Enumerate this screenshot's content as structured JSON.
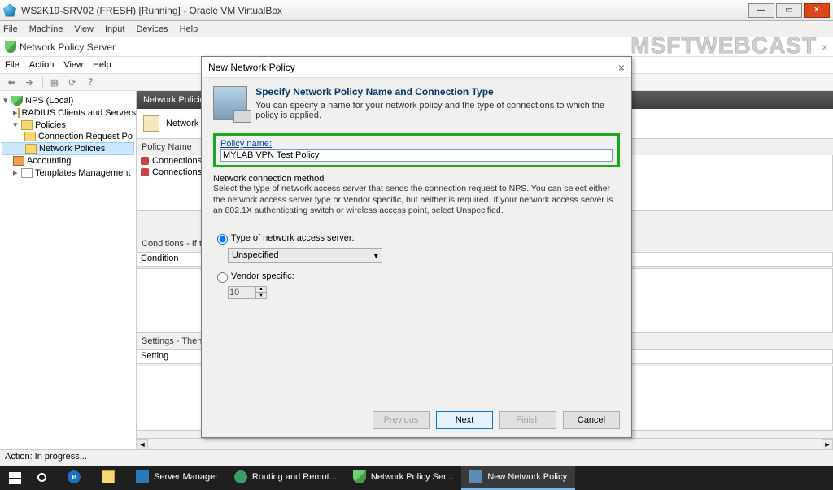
{
  "vbox": {
    "title": "WS2K19-SRV02 (FRESH) [Running] - Oracle VM VirtualBox",
    "menu": [
      "File",
      "Machine",
      "View",
      "Input",
      "Devices",
      "Help"
    ]
  },
  "watermark": "MSFTWEBCAST",
  "nps": {
    "title": "Network Policy Server",
    "menu": [
      "File",
      "Action",
      "View",
      "Help"
    ],
    "tree": {
      "root": "NPS (Local)",
      "radius": "RADIUS Clients and Servers",
      "policies": "Policies",
      "conn_req": "Connection Request Po",
      "net_pol": "Network Policies",
      "accounting": "Accounting",
      "templates": "Templates Management"
    },
    "col_header": "Network Policies",
    "banner_text": "Network policie",
    "policy_name_hdr": "Policy Name",
    "rows": [
      "Connections to Micr",
      "Connections to othe"
    ],
    "conditions_label": "Conditions - If the fol",
    "condition_hdr": "Condition",
    "settings_label": "Settings - Then the fo",
    "setting_hdr": "Setting",
    "status": "Action: In progress..."
  },
  "dialog": {
    "title": "New Network Policy",
    "heading": "Specify Network Policy Name and Connection Type",
    "sub": "You can specify a name for your network policy and the type of connections to which the policy is applied.",
    "policy_label": "Policy name:",
    "policy_value": "MYLAB VPN Test Policy",
    "ncm_label": "Network connection method",
    "ncm_desc": "Select the type of network access server that sends the connection request to NPS. You can select either the network access server type or Vendor specific, but neither is required.  If your network access server is an 802.1X authenticating switch or wireless access point, select Unspecified.",
    "radio_type": "Type of network access server:",
    "combo_value": "Unspecified",
    "radio_vendor": "Vendor specific:",
    "vendor_value": "10",
    "btn_prev": "Previous",
    "btn_next": "Next",
    "btn_finish": "Finish",
    "btn_cancel": "Cancel"
  },
  "taskbar": {
    "items": [
      {
        "label": "Server Manager"
      },
      {
        "label": "Routing and Remot..."
      },
      {
        "label": "Network Policy Ser..."
      },
      {
        "label": "New Network Policy"
      }
    ]
  }
}
